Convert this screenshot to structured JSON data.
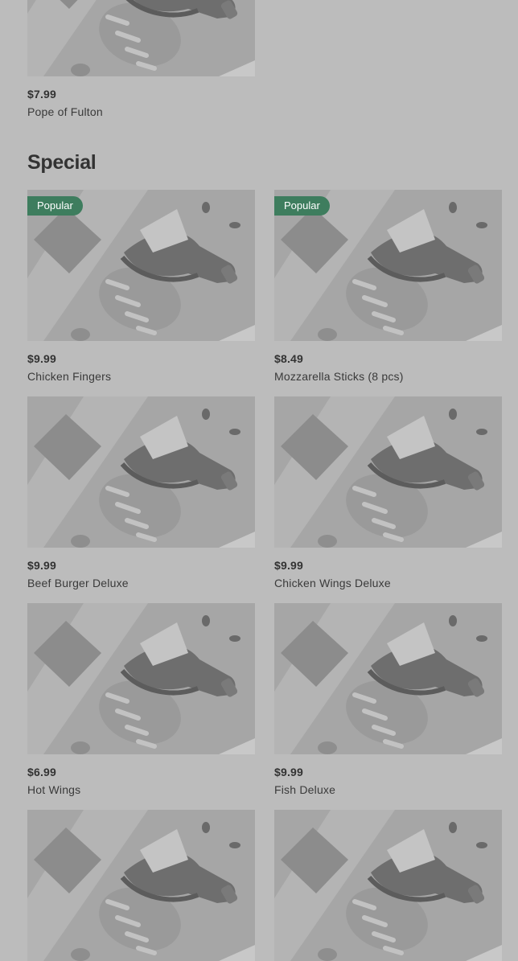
{
  "top_item": {
    "price": "$7.99",
    "name": "Pope of Fulton"
  },
  "section": {
    "title": "Special",
    "items": [
      {
        "price": "$9.99",
        "name": "Chicken Fingers",
        "badge": "Popular"
      },
      {
        "price": "$8.49",
        "name": "Mozzarella Sticks (8 pcs)",
        "badge": "Popular"
      },
      {
        "price": "$9.99",
        "name": "Beef Burger Deluxe",
        "badge": ""
      },
      {
        "price": "$9.99",
        "name": "Chicken Wings Deluxe",
        "badge": ""
      },
      {
        "price": "$6.99",
        "name": "Hot Wings",
        "badge": ""
      },
      {
        "price": "$9.99",
        "name": "Fish Deluxe",
        "badge": ""
      },
      {
        "price": "",
        "name": "",
        "badge": ""
      },
      {
        "price": "",
        "name": "",
        "badge": ""
      }
    ]
  },
  "colors": {
    "background": "#bcbcbc",
    "placeholder": "#a6a6a6",
    "badge": "#3e7d5e"
  },
  "icons": {
    "placeholder_image": "food-placeholder-illustration"
  }
}
